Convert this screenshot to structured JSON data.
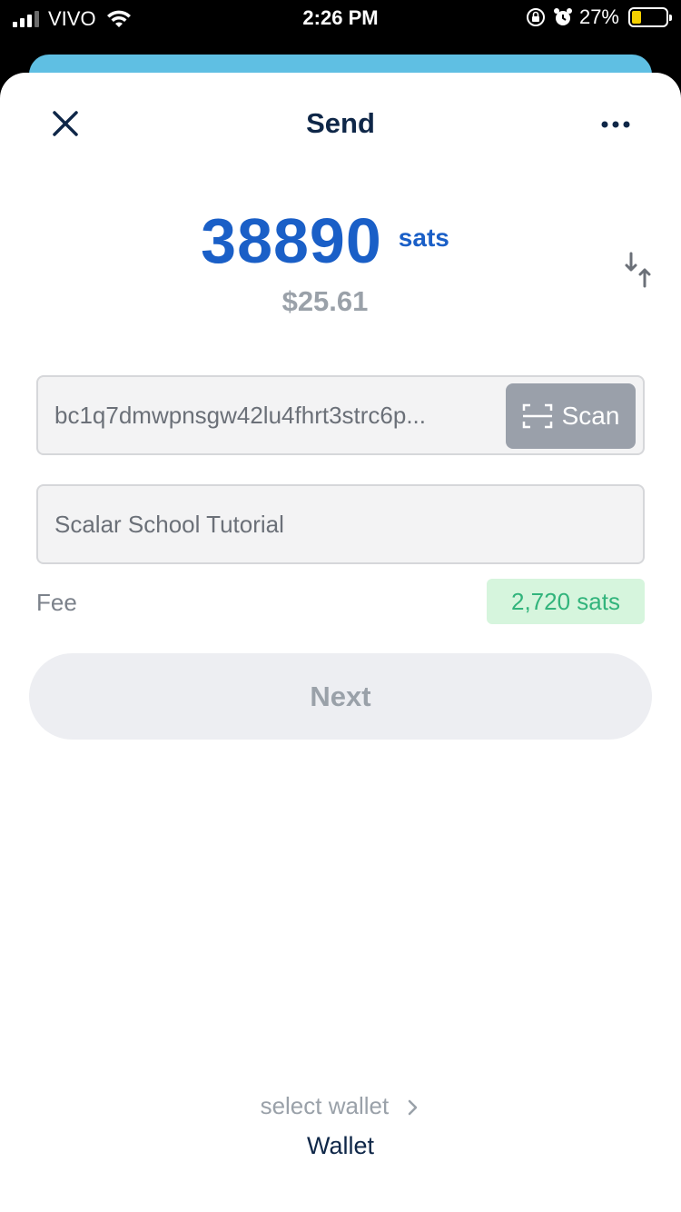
{
  "status_bar": {
    "carrier": "VIVO",
    "time": "2:26 PM",
    "battery_percent": "27%",
    "battery_color": "#f5d000"
  },
  "header": {
    "title": "Send",
    "close_icon": "close-icon",
    "more_icon": "more-horizontal-icon"
  },
  "amount": {
    "value": "38890",
    "unit": "sats",
    "fiat": "$25.61",
    "accent_color": "#1a5fc7",
    "swap_icon": "swap-vertical-icon"
  },
  "address": {
    "value": "bc1q7dmwpnsgw42lu4fhrt3strc6p...",
    "scan_label": "Scan",
    "scan_icon": "scan-icon"
  },
  "memo": {
    "value": "Scalar School Tutorial"
  },
  "fee": {
    "label": "Fee",
    "value": "2,720 sats"
  },
  "next_label": "Next",
  "wallet": {
    "select_label": "select wallet",
    "name": "Wallet"
  }
}
